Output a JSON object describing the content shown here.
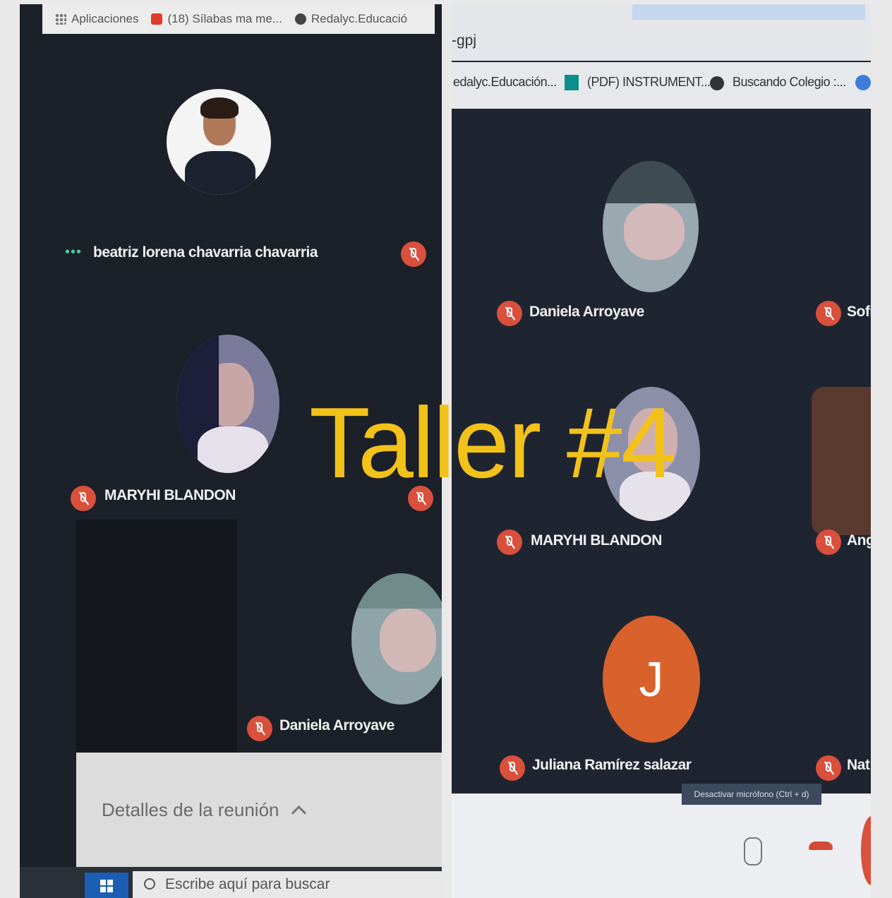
{
  "overlay_title": "Taller #4",
  "left": {
    "bookmarks": [
      {
        "label": "Aplicaciones",
        "icon": "apps-grid-icon"
      },
      {
        "label": "(18) Sílabas ma me...",
        "icon": "youtube-icon"
      },
      {
        "label": "Redalyc.Educació",
        "icon": "globe-icon"
      }
    ],
    "participants": [
      {
        "name": "beatriz lorena chavarria chavarria",
        "status": "speaking-dots"
      },
      {
        "name": "MARYHI BLANDON",
        "status": "muted"
      },
      {
        "name": "Daniela Arroyave",
        "status": "muted"
      }
    ],
    "meeting_details_label": "Detalles de la reunión",
    "taskbar_search_placeholder": "Escribe aquí para buscar"
  },
  "right": {
    "url_fragment": "-gpj",
    "bookmarks": [
      {
        "label": "edalyc.Educación...",
        "icon": "globe-icon"
      },
      {
        "label": "(PDF) INSTRUMENT...",
        "icon": "researchgate-icon"
      },
      {
        "label": "Buscando Colegio :...",
        "icon": "globe-icon"
      }
    ],
    "participants": [
      {
        "name": "Daniela Arroyave",
        "status": "muted"
      },
      {
        "name": "Sofi",
        "status": "muted"
      },
      {
        "name": "MARYHI BLANDON",
        "status": "muted"
      },
      {
        "name": "Ang",
        "status": "muted"
      },
      {
        "name": "Juliana Ramírez salazar",
        "status": "muted",
        "initial": "J"
      },
      {
        "name": "Nat",
        "status": "muted"
      }
    ],
    "tooltip": "Desactivar micrófono (Ctrl + d)"
  },
  "colors": {
    "overlay": "#f2c21a",
    "mic_muted": "#d9503d",
    "avatar_j": "#d8612c",
    "meeting_bg": "#1f2530"
  }
}
